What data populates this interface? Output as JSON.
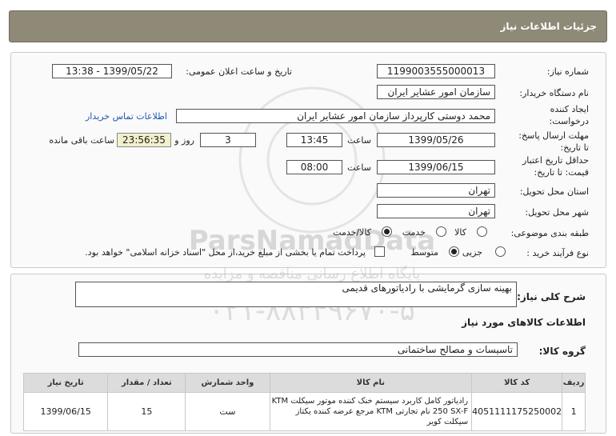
{
  "header": {
    "title": "جزئیات اطلاعات نیاز"
  },
  "fields": {
    "need_number_label": "شماره نیاز:",
    "need_number": "1199003555000013",
    "announce_label": "تاریخ و ساعت اعلان عمومی:",
    "announce_value": "1399/05/22 - 13:38",
    "buyer_org_label": "نام دستگاه خریدار:",
    "buyer_org": "سازمان امور عشایر ایران",
    "creator_label_1": "ایجاد کننده",
    "creator_label_2": "درخواست:",
    "creator": "محمد دوستی کارپرداز سازمان امور عشایر ایران",
    "contact_link": "اطلاعات تماس خریدار",
    "reply_label_1": "مهلت ارسال پاسخ:",
    "reply_label_2": "تا تاریخ:",
    "reply_date": "1399/05/26",
    "time_label": "ساعت",
    "reply_time": "13:45",
    "days_value": "3",
    "days_label": "روز و",
    "remaining_time": "23:56:35",
    "remaining_label": "ساعت باقی مانده",
    "validity_label_1": "حداقل تاریخ اعتبار",
    "validity_label_2": "قیمت: تا تاریخ:",
    "validity_date": "1399/06/15",
    "validity_time_label": "ساعت",
    "validity_time": "08:00",
    "province_label": "استان محل تحویل:",
    "province": "تهران",
    "city_label": "شهر محل تحویل:",
    "city": "تهران",
    "category_label": "طبقه بندی موضوعی:",
    "category_options": [
      "کالا",
      "خدمت",
      "کالا/خدمت"
    ],
    "category_selected": "کالا/خدمت",
    "process_label": "نوع فرآیند خرید :",
    "process_options": [
      "جزیی",
      "متوسط"
    ],
    "process_selected": "متوسط",
    "payment_note": "پرداخت تمام یا بخشی از مبلغ خرید،از محل \"اسناد خزانه اسلامی\" خواهد بود."
  },
  "details": {
    "description_label": "شرح کلی نیاز:",
    "description": "بهینه سازی گرمایشی با رادیاتورهای قدیمی",
    "goods_title": "اطلاعات کالاهای مورد نیاز",
    "group_label": "گروه کالا:",
    "group_value": "تاسیسات و مصالح ساختمانی"
  },
  "table": {
    "headers": [
      "ردیف",
      "کد کالا",
      "نام کالا",
      "واحد شمارش",
      "تعداد / مقدار",
      "تاریخ نیاز"
    ],
    "rows": [
      {
        "index": "1",
        "code": "4051111175250002",
        "name": "رادیاتور کامل کاربرد سیستم خنک کننده موتور سیکلت KTM 250 SX-F نام تجارتی KTM مرجع عرضه کننده یکتاز سیکلت کویر",
        "unit": "ست",
        "qty": "15",
        "date": "1399/06/15"
      }
    ]
  },
  "watermark": {
    "line1": "ParsNamadData",
    "line2": "پایگاه اطلاع رسانی مناقصه و مزایده",
    "line3": "۰۲۱-۸۸۳۴۹۶۷۰-۵"
  },
  "colors": {
    "header_bg": "#8f8977",
    "link": "#1f54b4",
    "timer_bg": "#f1f0cc"
  }
}
